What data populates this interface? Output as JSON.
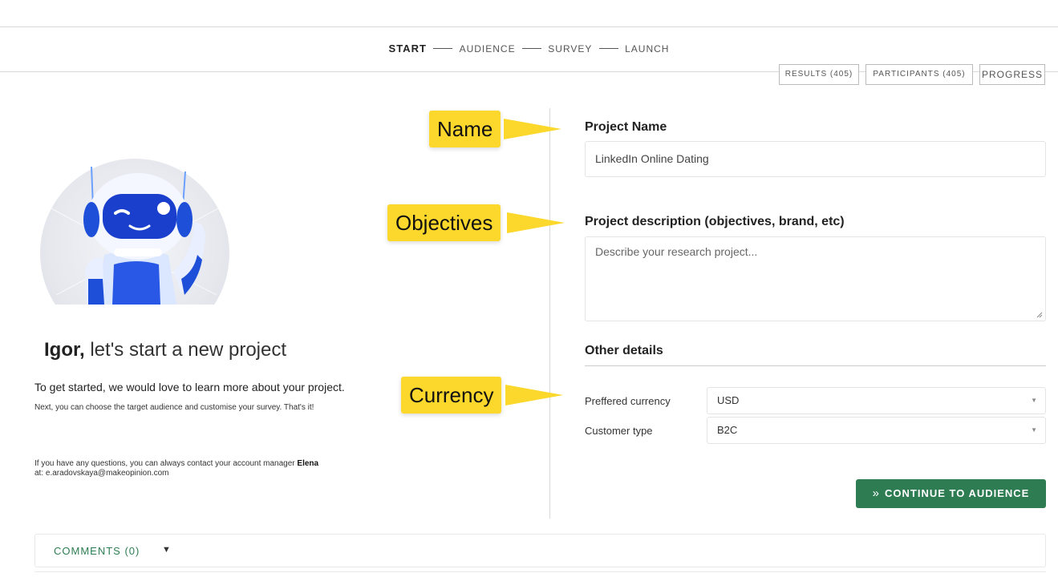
{
  "stepper": {
    "steps": [
      "START",
      "AUDIENCE",
      "SURVEY",
      "LAUNCH"
    ],
    "active": "START"
  },
  "tabs": {
    "results": "RESULTS (405)",
    "participants": "PARTICIPANTS (405)",
    "progress": "PROGRESS"
  },
  "intro": {
    "name": "Igor,",
    "greeting_rest": " let's start a new project",
    "line1": "To get started, we would love to learn more about your project.",
    "line2": "Next, you can choose the target audience and customise your survey. That's it!",
    "contact_prefix": "If you have any questions, you can always contact your account manager ",
    "manager": "Elena",
    "contact_suffix": "at: e.aradovskaya@makeopinion.com"
  },
  "callouts": {
    "name": "Name",
    "objectives": "Objectives",
    "currency": "Currency"
  },
  "form": {
    "project_name_label": "Project Name",
    "project_name_value": "LinkedIn Online Dating",
    "description_label": "Project description (objectives, brand, etc)",
    "description_placeholder": "Describe your research project...",
    "other_details_label": "Other details",
    "currency_label": "Preffered currency",
    "currency_value": "USD",
    "customer_type_label": "Customer type",
    "customer_type_value": "B2C"
  },
  "actions": {
    "continue": "CONTINUE TO AUDIENCE",
    "continue_icon": "double-chevron-right-icon"
  },
  "comments": {
    "label": "COMMENTS (0)"
  },
  "colors": {
    "accent_green": "#2e7d52",
    "callout_yellow": "#fcd72c",
    "robot_blue": "#1e4fd8"
  }
}
